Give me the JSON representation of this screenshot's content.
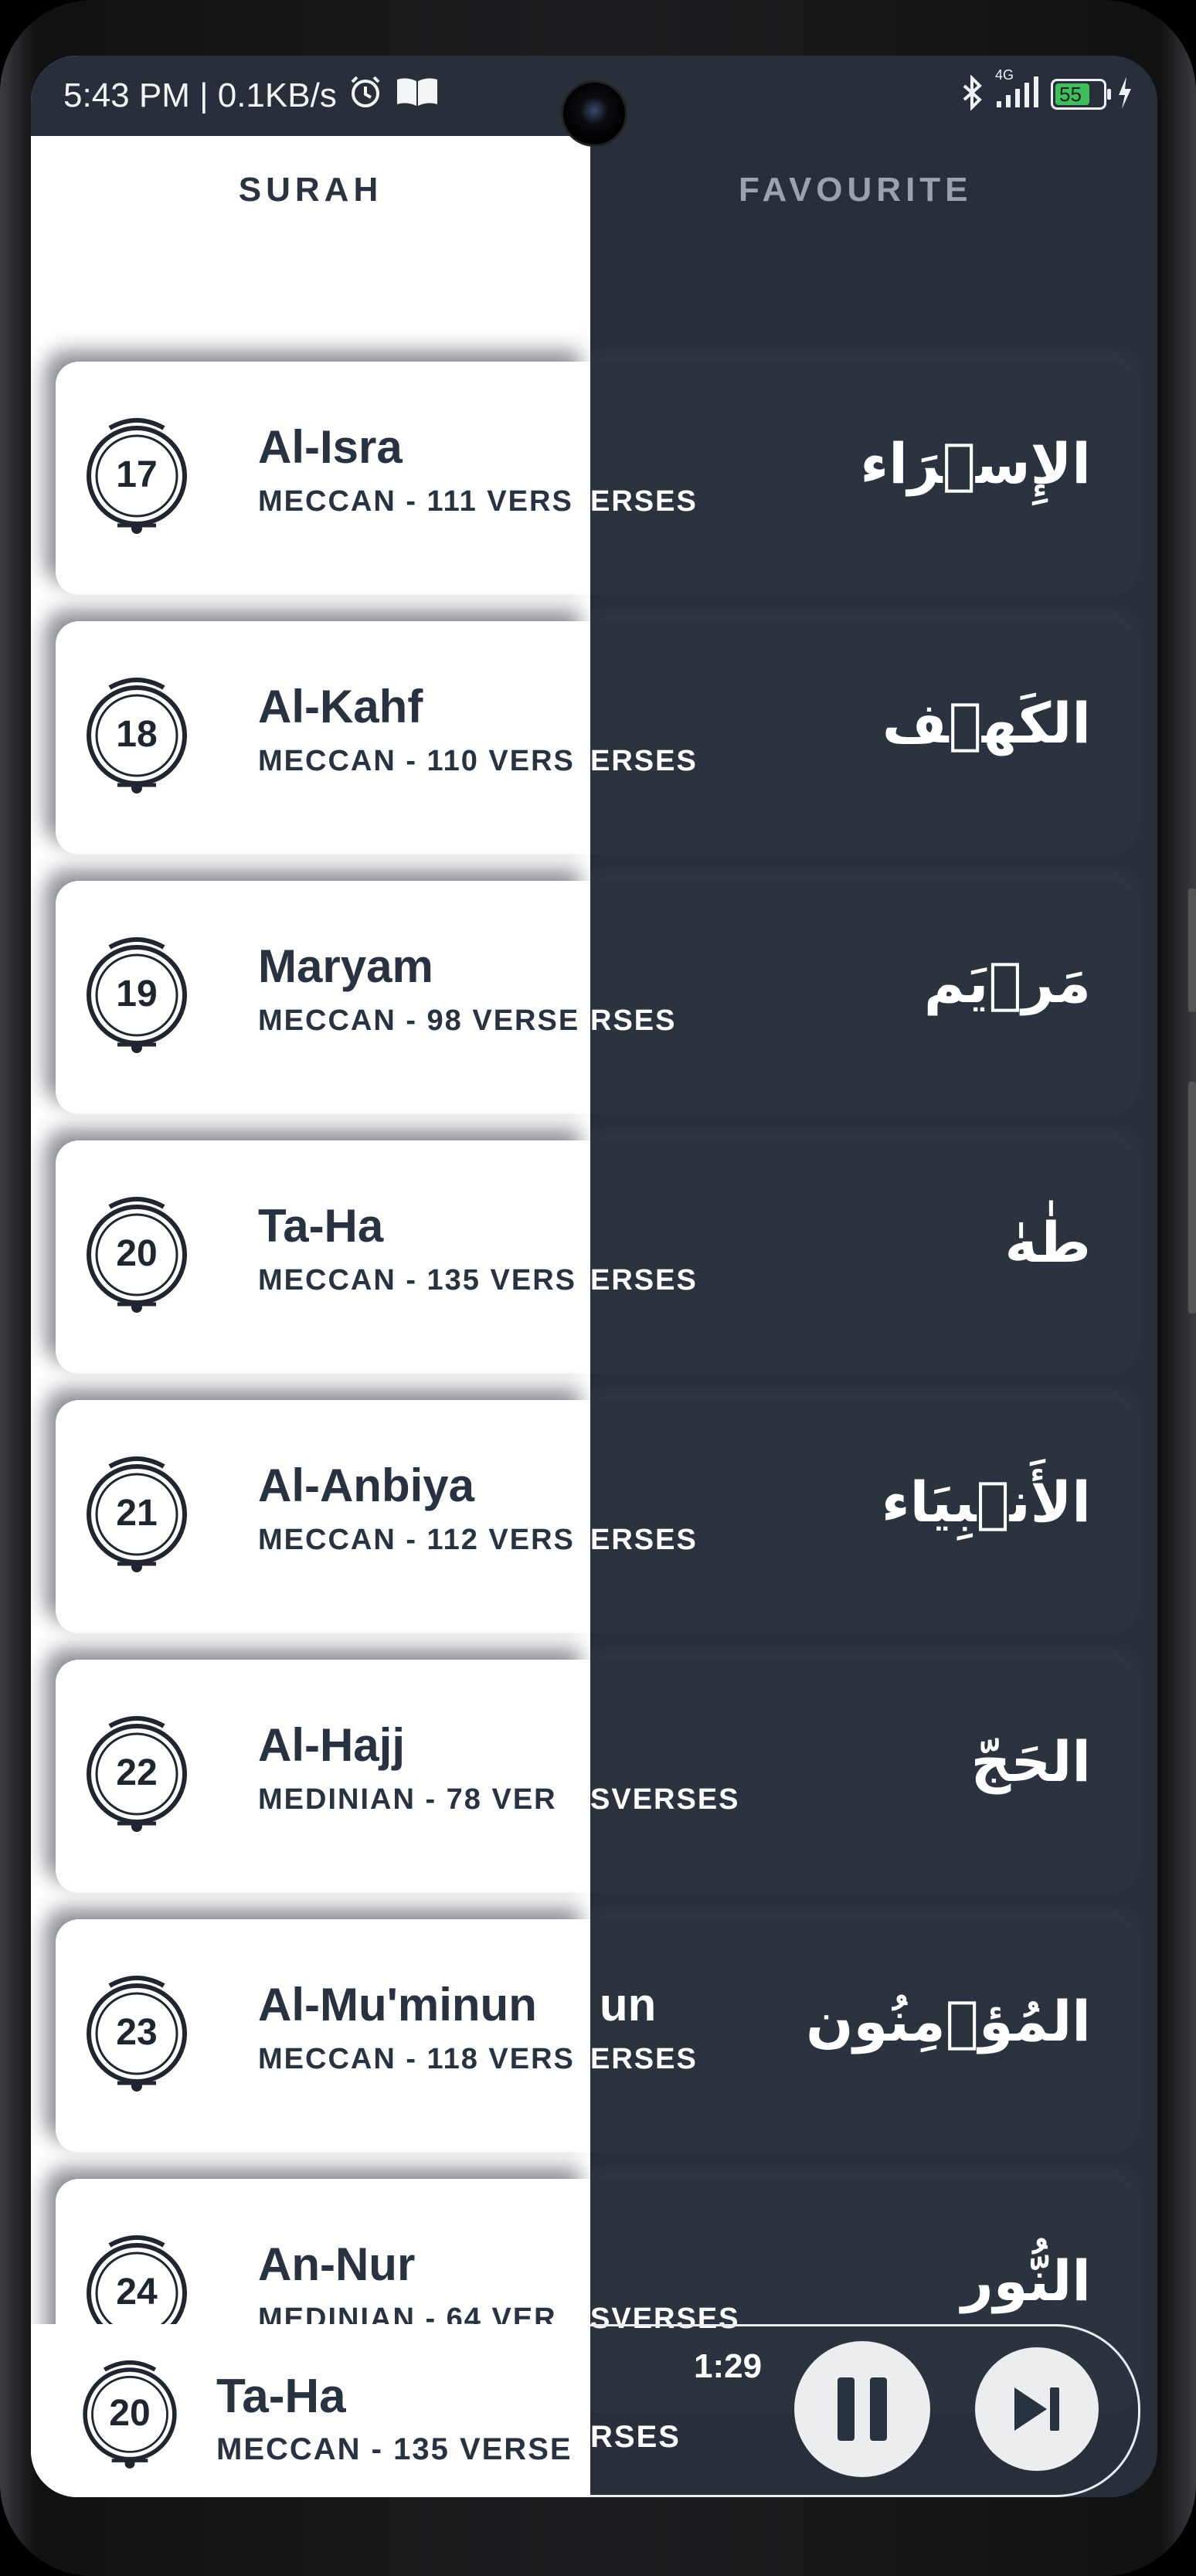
{
  "status": {
    "time_speed": "5:43 PM | 0.1KB/s",
    "network": "4G",
    "battery": "55",
    "icons": [
      "alarm-icon",
      "book-icon",
      "bluetooth-icon",
      "signal-icon",
      "battery-icon",
      "charging-icon"
    ]
  },
  "tabs": {
    "surah": "SURAH",
    "favourite": "FAVOURITE"
  },
  "surahs": [
    {
      "number": "17",
      "name": "Al-Isra",
      "name_right": "",
      "meta": "MECCAN - 111 VERS",
      "meta_right": "ERSES",
      "arabic": "الإِسۡرَاء"
    },
    {
      "number": "18",
      "name": "Al-Kahf",
      "name_right": "",
      "meta": "MECCAN - 110 VERS",
      "meta_right": "ERSES",
      "arabic": "الكَهۡف"
    },
    {
      "number": "19",
      "name": "Maryam",
      "name_right": "",
      "meta": "MECCAN - 98 VERSE",
      "meta_right": "RSES",
      "arabic": "مَرۡيَم"
    },
    {
      "number": "20",
      "name": "Ta-Ha",
      "name_right": "",
      "meta": "MECCAN - 135 VERS",
      "meta_right": "ERSES",
      "arabic": "طٰهٰ"
    },
    {
      "number": "21",
      "name": "Al-Anbiya",
      "name_right": "",
      "meta": "MECCAN - 112 VERS",
      "meta_right": "ERSES",
      "arabic": "الأَنۡبِيَاء"
    },
    {
      "number": "22",
      "name": "Al-Hajj",
      "name_right": "",
      "meta": "MEDINIAN - 78 VER",
      "meta_right": "SVERSES",
      "arabic": "الحَجّ"
    },
    {
      "number": "23",
      "name": "Al-Mu'minun",
      "name_right": "un",
      "meta": "MECCAN - 118 VERS",
      "meta_right": "ERSES",
      "arabic": "المُؤۡمِنُون"
    },
    {
      "number": "24",
      "name": "An-Nur",
      "name_right": "",
      "meta": "MEDINIAN - 64 VER",
      "meta_right": "SVERSES",
      "arabic": "النُّور"
    }
  ],
  "player": {
    "number": "20",
    "title": "Ta-Ha",
    "meta": "MECCAN - 135 VERSE",
    "meta_right": "RSES",
    "time": "1:29",
    "pause_icon": "pause-icon",
    "next_icon": "skip-next-icon"
  },
  "colors": {
    "dark_bg": "#282f3a",
    "light_bg": "#ffffff",
    "text_dark": "#283240",
    "text_light": "#ffffff"
  }
}
